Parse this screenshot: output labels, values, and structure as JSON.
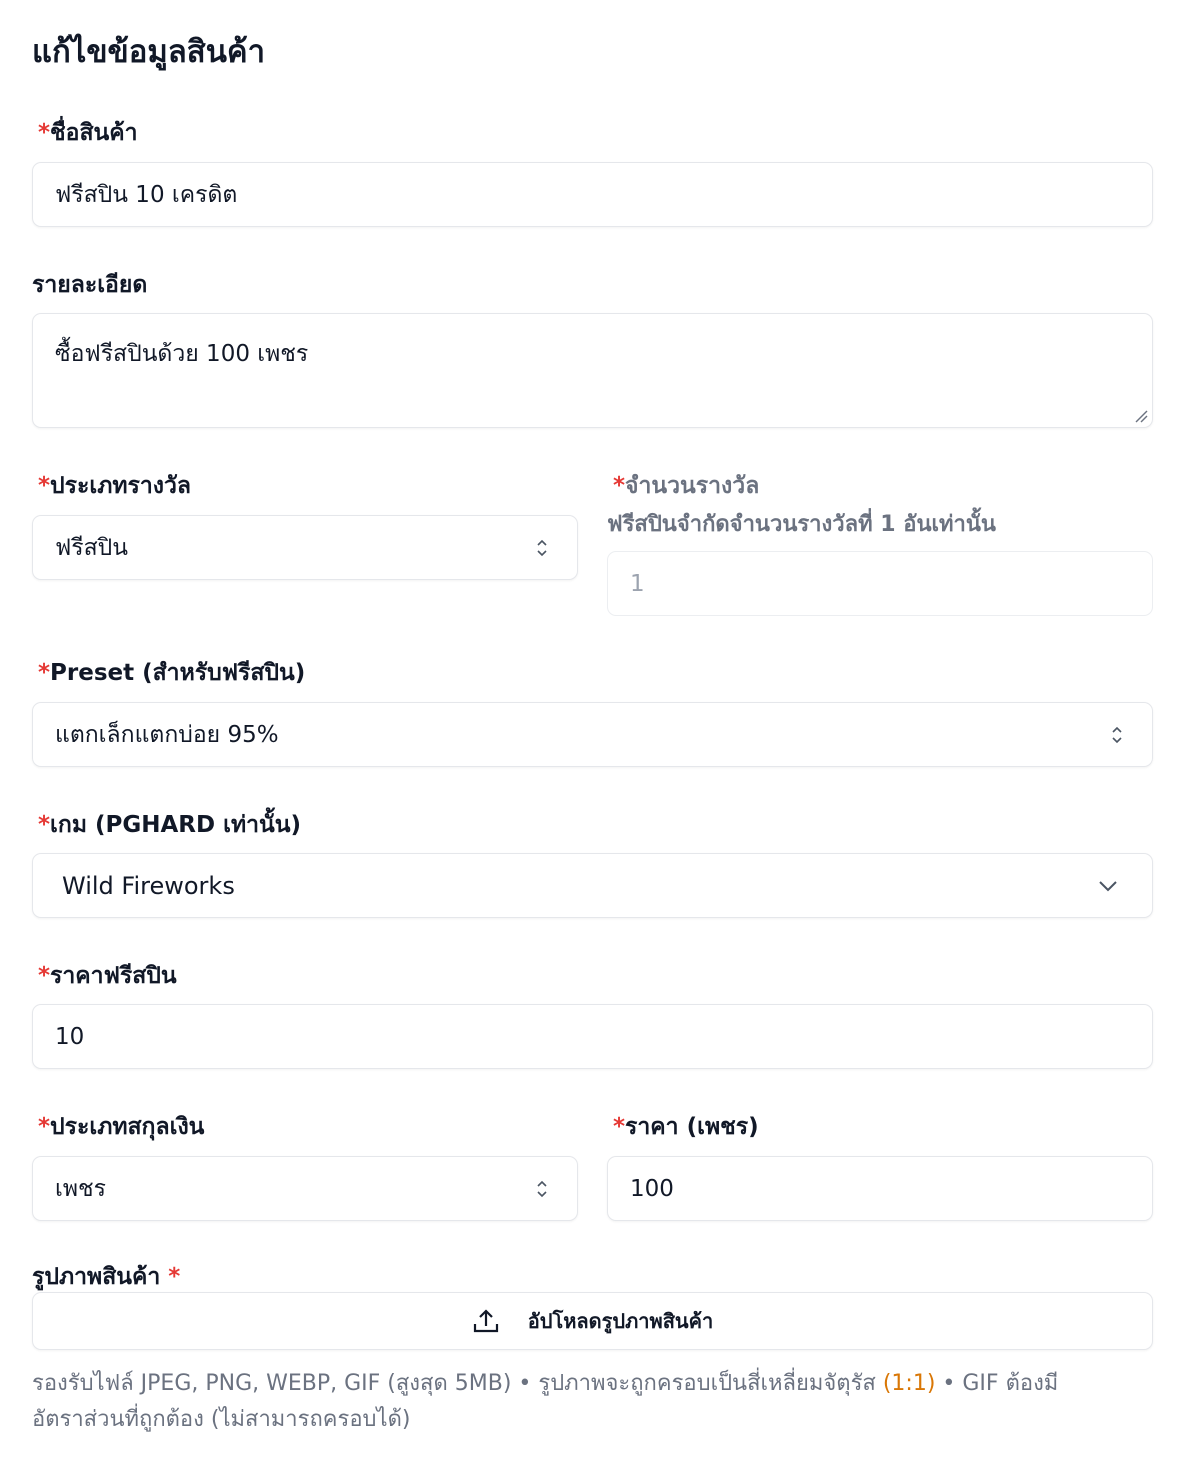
{
  "page_title": "แก้ไขข้อมูลสินค้า",
  "required_mark": "*",
  "product_name": {
    "label": "ชื่อสินค้า",
    "value": "ฟรีสปิน 10 เครดิต"
  },
  "description": {
    "label": "รายละเอียด",
    "value": "ซื้อฟรีสปินด้วย 100 เพชร"
  },
  "reward_type": {
    "label": "ประเภทรางวัล",
    "value": "ฟรีสปิน"
  },
  "reward_amount": {
    "label": "จำนวนรางวัล",
    "note": "ฟรีสปินจำกัดจำนวนรางวัลที่ 1 อันเท่านั้น",
    "value": "1"
  },
  "preset": {
    "label": "Preset (สำหรับฟรีสปิน)",
    "value": "แตกเล็กแตกบ่อย 95%"
  },
  "game": {
    "label": "เกม (PGHARD เท่านั้น)",
    "value": "Wild Fireworks"
  },
  "freespin_price": {
    "label": "ราคาฟรีสปิน",
    "value": "10"
  },
  "currency_type": {
    "label": "ประเภทสกุลเงิน",
    "value": "เพชร"
  },
  "price": {
    "label": "ราคา (เพชร)",
    "value": "100"
  },
  "image": {
    "label": "รูปภาพสินค้า",
    "upload_label": "อัปโหลดรูปภาพสินค้า",
    "help_before": "รองรับไฟล์ JPEG, PNG, WEBP, GIF (สูงสุด 5MB) • รูปภาพจะถูกครอบเป็นสี่เหลี่ยมจัตุรัส ",
    "help_ratio": "(1:1)",
    "help_after": " • GIF ต้องมีอัตราส่วนที่ถูกต้อง (ไม่สามารถครอบได้)"
  },
  "colors": {
    "required": "#e53935",
    "muted": "#6b7280",
    "accent": "#d97706",
    "border": "#e5e7eb"
  },
  "icons": [
    "updown-icon",
    "chevron-down-icon",
    "upload-icon",
    "resize-handle-icon"
  ]
}
